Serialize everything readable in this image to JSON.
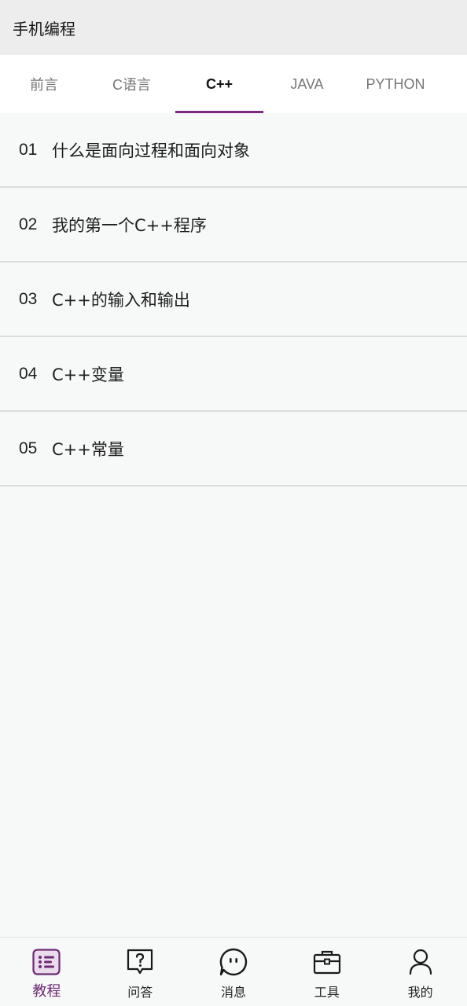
{
  "app": {
    "title": "手机编程"
  },
  "tabs": [
    {
      "label": "前言",
      "active": false
    },
    {
      "label": "C语言",
      "active": false
    },
    {
      "label": "C++",
      "active": true
    },
    {
      "label": "JAVA",
      "active": false
    },
    {
      "label": "PYTHON",
      "active": false
    }
  ],
  "lessons": [
    {
      "num": "01",
      "title": "什么是面向过程和面向对象"
    },
    {
      "num": "02",
      "title": "我的第一个C++程序"
    },
    {
      "num": "03",
      "title": "C++的输入和输出"
    },
    {
      "num": "04",
      "title": "C++变量"
    },
    {
      "num": "05",
      "title": "C++常量"
    }
  ],
  "bottom_nav": [
    {
      "label": "教程",
      "icon": "tutorial-list-icon",
      "active": true
    },
    {
      "label": "问答",
      "icon": "question-chat-icon",
      "active": false
    },
    {
      "label": "消息",
      "icon": "message-bubble-icon",
      "active": false
    },
    {
      "label": "工具",
      "icon": "toolbox-icon",
      "active": false
    },
    {
      "label": "我的",
      "icon": "profile-person-icon",
      "active": false
    }
  ],
  "colors": {
    "accent": "#7a2b7f",
    "titlebar_bg": "#ededed",
    "page_bg": "#f7f8f8",
    "tabs_bg": "#ffffff"
  }
}
